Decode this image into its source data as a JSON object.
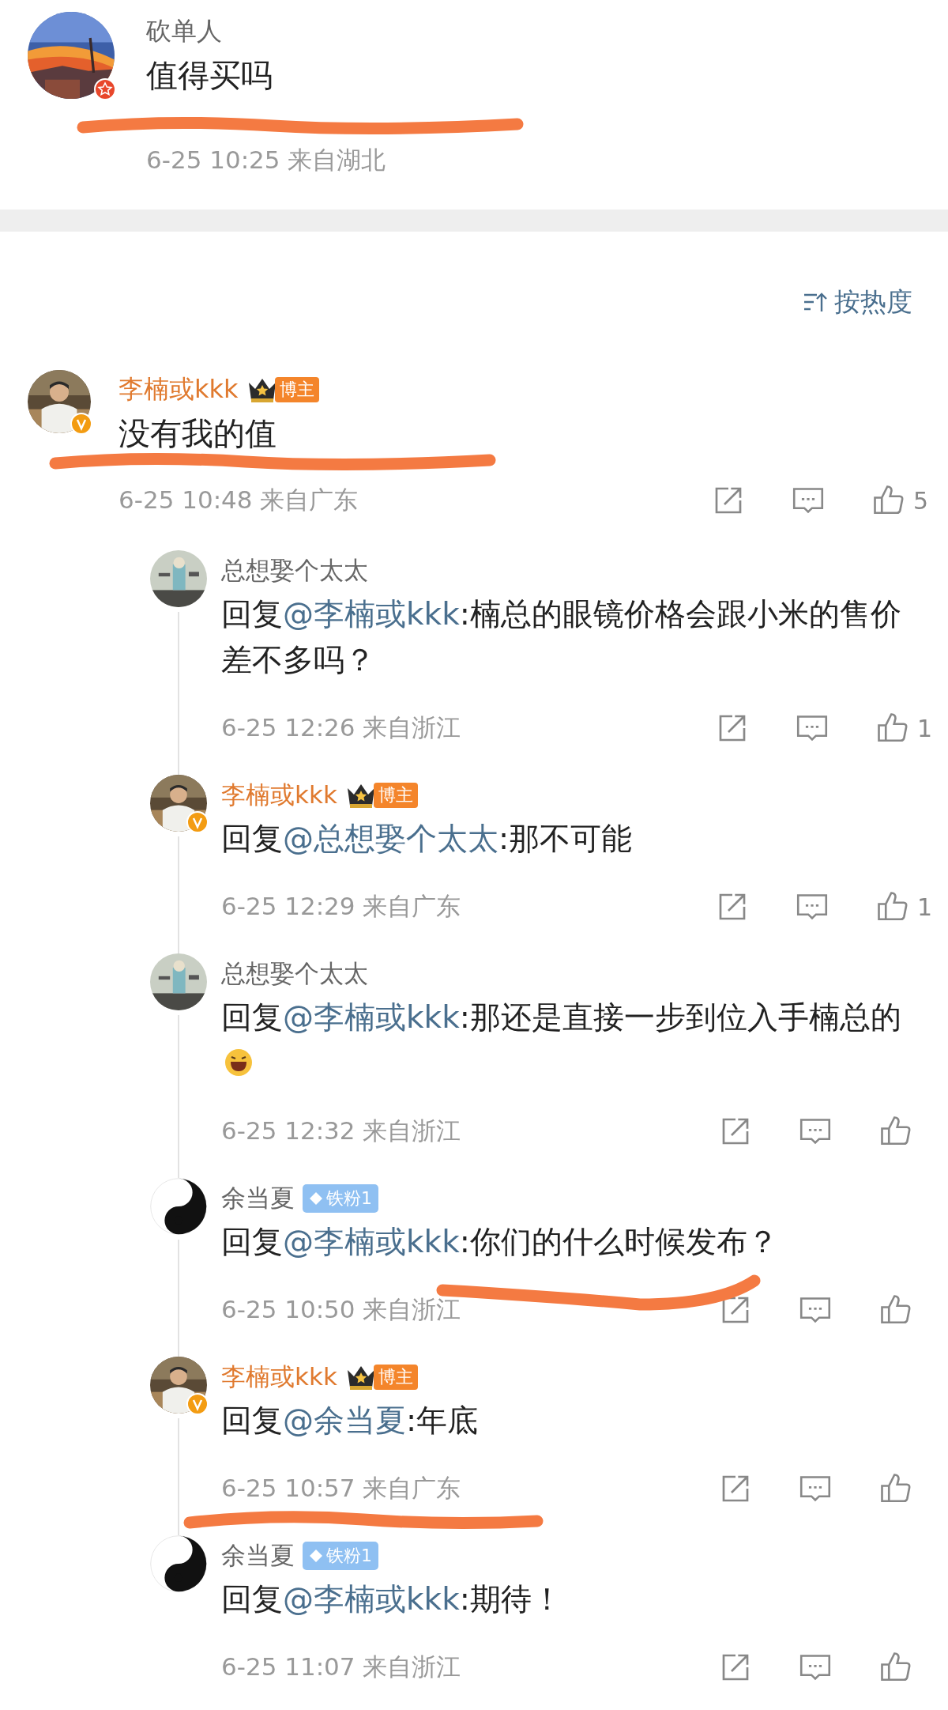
{
  "post": {
    "author": "砍单人",
    "text": "值得买吗",
    "time": "6-25 10:25",
    "region": "来自湖北",
    "avatar_badge": {
      "kind": "star"
    },
    "scribble": {
      "kind": "date"
    }
  },
  "sort": {
    "label": "按热度"
  },
  "comment": {
    "author": "李楠或kkk",
    "badge": {
      "kind": "crown",
      "label": "博主"
    },
    "avatar_badge": {
      "kind": "v"
    },
    "text": "没有我的值",
    "time": "6-25 10:48",
    "region": "来自广东",
    "likes": "5",
    "scribble": {
      "kind": "date"
    },
    "replies": [
      {
        "author": "总想娶个太太",
        "prefix": "回复",
        "mention": "@李楠或kkk",
        "text": ":楠总的眼镜价格会跟小米的售价差不多吗？",
        "time": "6-25 12:26",
        "region": "来自浙江",
        "likes": "1"
      },
      {
        "author": "李楠或kkk",
        "badge": {
          "kind": "crown",
          "label": "博主"
        },
        "avatar_badge": {
          "kind": "v"
        },
        "prefix": "回复",
        "mention": "@总想娶个太太",
        "text": ":那不可能",
        "time": "6-25 12:29",
        "region": "来自广东",
        "likes": "1"
      },
      {
        "author": "总想娶个太太",
        "prefix": "回复",
        "mention": "@李楠或kkk",
        "text": ":那还是直接一步到位入手楠总的",
        "emoji": {
          "kind": "grin"
        },
        "time": "6-25 12:32",
        "region": "来自浙江"
      },
      {
        "author": "余当夏",
        "badge": {
          "kind": "fan",
          "label": "铁粉1"
        },
        "prefix": "回复",
        "mention": "@李楠或kkk",
        "text": ":你们的什么时候发布？",
        "time": "6-25 10:50",
        "region": "来自浙江",
        "scribble": {
          "kind": "icons"
        }
      },
      {
        "author": "李楠或kkk",
        "badge": {
          "kind": "crown",
          "label": "博主"
        },
        "avatar_badge": {
          "kind": "v"
        },
        "prefix": "回复",
        "mention": "@余当夏",
        "text": ":年底",
        "time": "6-25 10:57",
        "region": "来自广东",
        "scribble": {
          "kind": "below"
        }
      },
      {
        "author": "余当夏",
        "badge": {
          "kind": "fan",
          "label": "铁粉1"
        },
        "prefix": "回复",
        "mention": "@李楠或kkk",
        "text": ":期待！",
        "time": "6-25 11:07",
        "region": "来自浙江"
      }
    ]
  }
}
